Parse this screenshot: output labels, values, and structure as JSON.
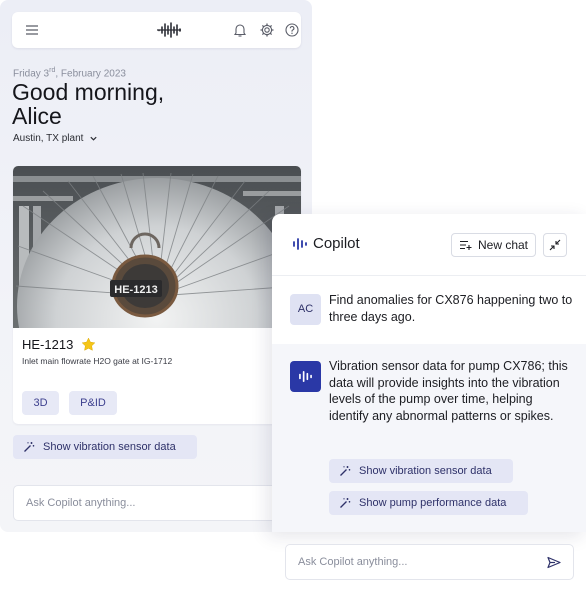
{
  "app": {
    "date_prefix": "Friday 3",
    "date_sup": "rd",
    "date_suffix": ", February 2023",
    "greeting_line1": "Good morning,",
    "greeting_line2": "Alice",
    "location": "Austin, TX plant"
  },
  "topbar": {
    "icons": [
      "menu-icon",
      "brand-logo",
      "bell-icon",
      "gear-icon",
      "help-icon"
    ]
  },
  "asset": {
    "plate_label": "HE-1213",
    "title": "HE-1213",
    "description": "Inlet main flowrate H2O gate at IG-1712",
    "chips": [
      "3D",
      "P&ID"
    ]
  },
  "left_action": {
    "label": "Show vibration sensor data"
  },
  "left_input": {
    "placeholder": "Ask Copilot anything..."
  },
  "copilot": {
    "title": "Copilot",
    "new_chat_label": "New chat",
    "user_initials": "AC",
    "user_message": "Find anomalies for CX876 happening two to three days ago.",
    "bot_message": "Vibration sensor data for pump CX786; this data will provide insights into the vibration levels of the pump over time, helping identify any abnormal patterns or spikes.",
    "actions": [
      "Show vibration sensor data",
      "Show pump performance data"
    ],
    "input_placeholder": "Ask Copilot anything..."
  },
  "colors": {
    "accent": "#2a38a6",
    "chip_bg": "#e7e9f6",
    "star": "#f5c518"
  }
}
